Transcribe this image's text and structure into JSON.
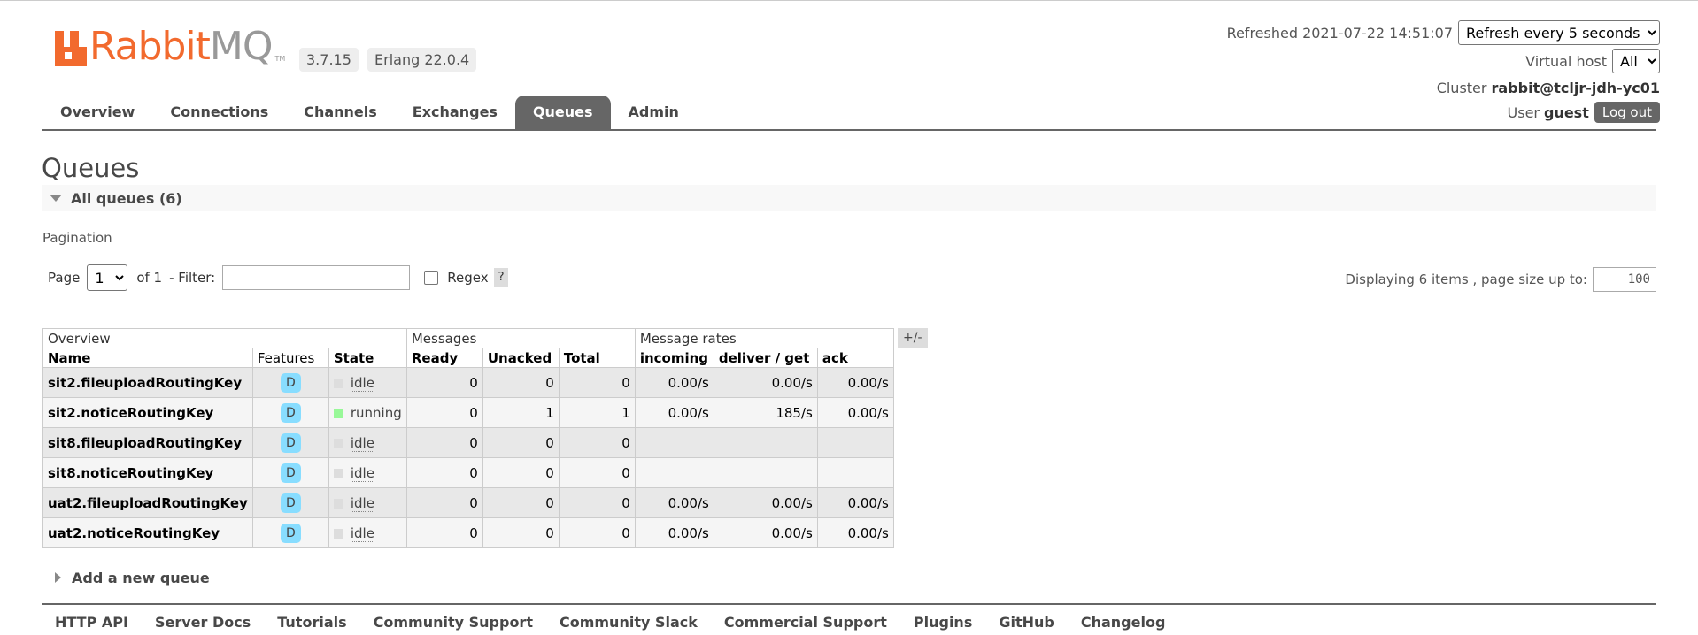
{
  "header": {
    "logo_rabbit": "Rabbit",
    "logo_mq": "MQ",
    "logo_tm": "TM",
    "version": "3.7.15",
    "erlang": "Erlang 22.0.4"
  },
  "top_right": {
    "refreshed": "Refreshed 2021-07-22 14:51:07",
    "refresh_select": "Refresh every 5 seconds",
    "vhost_label": "Virtual host",
    "vhost_select": "All",
    "cluster_label": "Cluster",
    "cluster_value": "rabbit@tcljr-jdh-yc01",
    "user_label": "User",
    "user_value": "guest",
    "logout": "Log out"
  },
  "nav": {
    "tabs": [
      "Overview",
      "Connections",
      "Channels",
      "Exchanges",
      "Queues",
      "Admin"
    ],
    "active": "Queues"
  },
  "page": {
    "title": "Queues",
    "all_queues": "All queues (6)",
    "pagination": "Pagination",
    "page_label": "Page",
    "page_select": "1",
    "of_label": "of 1",
    "filter_label": "- Filter:",
    "filter_value": "",
    "regex_label": "Regex",
    "help": "?",
    "displaying": "Displaying 6 items , page size up to:",
    "page_size": "100",
    "add_queue": "Add a new queue"
  },
  "table": {
    "groups": [
      "Overview",
      "Messages",
      "Message rates"
    ],
    "plus_minus": "+/-",
    "columns": [
      "Name",
      "Features",
      "State",
      "Ready",
      "Unacked",
      "Total",
      "incoming",
      "deliver / get",
      "ack"
    ],
    "rows": [
      {
        "name": "sit2.fileuploadRoutingKey",
        "feature": "D",
        "state": "idle",
        "ready": "0",
        "unacked": "0",
        "total": "0",
        "incoming": "0.00/s",
        "deliver": "0.00/s",
        "ack": "0.00/s"
      },
      {
        "name": "sit2.noticeRoutingKey",
        "feature": "D",
        "state": "running",
        "ready": "0",
        "unacked": "1",
        "total": "1",
        "incoming": "0.00/s",
        "deliver": "185/s",
        "ack": "0.00/s"
      },
      {
        "name": "sit8.fileuploadRoutingKey",
        "feature": "D",
        "state": "idle",
        "ready": "0",
        "unacked": "0",
        "total": "0",
        "incoming": "",
        "deliver": "",
        "ack": ""
      },
      {
        "name": "sit8.noticeRoutingKey",
        "feature": "D",
        "state": "idle",
        "ready": "0",
        "unacked": "0",
        "total": "0",
        "incoming": "",
        "deliver": "",
        "ack": ""
      },
      {
        "name": "uat2.fileuploadRoutingKey",
        "feature": "D",
        "state": "idle",
        "ready": "0",
        "unacked": "0",
        "total": "0",
        "incoming": "0.00/s",
        "deliver": "0.00/s",
        "ack": "0.00/s"
      },
      {
        "name": "uat2.noticeRoutingKey",
        "feature": "D",
        "state": "idle",
        "ready": "0",
        "unacked": "0",
        "total": "0",
        "incoming": "0.00/s",
        "deliver": "0.00/s",
        "ack": "0.00/s"
      }
    ]
  },
  "footer": {
    "links": [
      "HTTP API",
      "Server Docs",
      "Tutorials",
      "Community Support",
      "Community Slack",
      "Commercial Support",
      "Plugins",
      "GitHub",
      "Changelog"
    ]
  },
  "colors": {
    "brand_orange": "#f26a2e",
    "nav_active": "#666666",
    "badge_durable": "#88ddff",
    "state_running": "#98f898",
    "state_idle": "#dddddd"
  }
}
